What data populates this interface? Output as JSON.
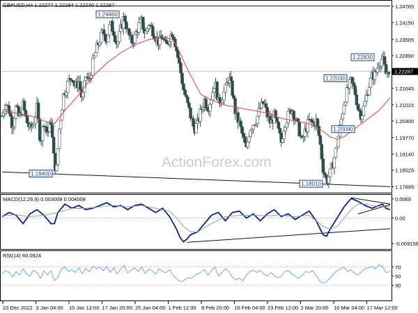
{
  "chart_data": [
    {
      "type": "candlestick",
      "title": "GBPUSD,H4  1.22277 1.22294 1.22230 1.22287",
      "ylim": [
        1.1775,
        1.2485
      ],
      "y_ticks": [
        "1.24765",
        "1.24150",
        "1.23505",
        "1.22890",
        "1.22287",
        "1.21645",
        "1.21015",
        "1.20400",
        "1.19770",
        "1.19140",
        "1.18525",
        "1.17895"
      ],
      "current_price": "1.22287",
      "x_ticks": [
        "23 Dec 2022",
        "3 Jan 04:00",
        "10 Jan 12:00",
        "17 Jan 20:00",
        "25 Jan 04:00",
        "1 Feb 12:00",
        "8 Feb 20:00",
        "16 Feb 04:00",
        "23 Feb 12:00",
        "2 Mar 20:00",
        "10 Mar 04:00",
        "17 Mar 12:00"
      ],
      "annotations": [
        {
          "label": "1.24460",
          "value": 1.2446
        },
        {
          "label": "1.18400",
          "value": 1.184
        },
        {
          "label": "1.22830",
          "value": 1.2283
        },
        {
          "label": "1.22030",
          "value": 1.2203
        },
        {
          "label": "1.20090",
          "value": 1.2009
        },
        {
          "label": "1.18010",
          "value": 1.1801
        }
      ],
      "price_path": [
        [
          0,
          1.206
        ],
        [
          5,
          1.211
        ],
        [
          10,
          1.208
        ],
        [
          15,
          1.202
        ],
        [
          20,
          1.209
        ],
        [
          25,
          1.205
        ],
        [
          30,
          1.21
        ],
        [
          35,
          1.204
        ],
        [
          40,
          1.201
        ],
        [
          45,
          1.203
        ],
        [
          50,
          1.209
        ],
        [
          55,
          1.196
        ],
        [
          60,
          1.204
        ],
        [
          65,
          1.199
        ],
        [
          70,
          1.204
        ],
        [
          75,
          1.187
        ],
        [
          78,
          1.186
        ],
        [
          82,
          1.201
        ],
        [
          88,
          1.214
        ],
        [
          95,
          1.219
        ],
        [
          100,
          1.221
        ],
        [
          105,
          1.217
        ],
        [
          110,
          1.219
        ],
        [
          115,
          1.212
        ],
        [
          120,
          1.221
        ],
        [
          125,
          1.219
        ],
        [
          130,
          1.226
        ],
        [
          135,
          1.231
        ],
        [
          140,
          1.235
        ],
        [
          145,
          1.238
        ],
        [
          150,
          1.235
        ],
        [
          155,
          1.241
        ],
        [
          160,
          1.238
        ],
        [
          165,
          1.233
        ],
        [
          170,
          1.239
        ],
        [
          175,
          1.244
        ],
        [
          180,
          1.238
        ],
        [
          185,
          1.234
        ],
        [
          190,
          1.236
        ],
        [
          195,
          1.24
        ],
        [
          200,
          1.242
        ],
        [
          205,
          1.237
        ],
        [
          210,
          1.241
        ],
        [
          215,
          1.239
        ],
        [
          220,
          1.236
        ],
        [
          225,
          1.234
        ],
        [
          230,
          1.236
        ],
        [
          235,
          1.232
        ],
        [
          240,
          1.236
        ],
        [
          245,
          1.238
        ],
        [
          250,
          1.231
        ],
        [
          255,
          1.224
        ],
        [
          260,
          1.216
        ],
        [
          265,
          1.211
        ],
        [
          270,
          1.206
        ],
        [
          275,
          1.201
        ],
        [
          280,
          1.203
        ],
        [
          285,
          1.208
        ],
        [
          290,
          1.212
        ],
        [
          295,
          1.209
        ],
        [
          300,
          1.213
        ],
        [
          305,
          1.219
        ],
        [
          310,
          1.211
        ],
        [
          315,
          1.213
        ],
        [
          320,
          1.216
        ],
        [
          325,
          1.221
        ],
        [
          330,
          1.215
        ],
        [
          335,
          1.206
        ],
        [
          340,
          1.203
        ],
        [
          345,
          1.198
        ],
        [
          350,
          1.193
        ],
        [
          355,
          1.201
        ],
        [
          360,
          1.203
        ],
        [
          365,
          1.205
        ],
        [
          370,
          1.209
        ],
        [
          375,
          1.211
        ],
        [
          380,
          1.206
        ],
        [
          385,
          1.203
        ],
        [
          390,
          1.206
        ],
        [
          395,
          1.201
        ],
        [
          400,
          1.196
        ],
        [
          405,
          1.203
        ],
        [
          410,
          1.206
        ],
        [
          415,
          1.209
        ],
        [
          420,
          1.205
        ],
        [
          425,
          1.201
        ],
        [
          430,
          1.196
        ],
        [
          435,
          1.201
        ],
        [
          440,
          1.204
        ],
        [
          445,
          1.203
        ],
        [
          450,
          1.204
        ],
        [
          455,
          1.197
        ],
        [
          460,
          1.186
        ],
        [
          465,
          1.181
        ],
        [
          470,
          1.184
        ],
        [
          475,
          1.189
        ],
        [
          480,
          1.195
        ],
        [
          485,
          1.203
        ],
        [
          490,
          1.211
        ],
        [
          495,
          1.216
        ],
        [
          500,
          1.219
        ],
        [
          505,
          1.216
        ],
        [
          510,
          1.209
        ],
        [
          515,
          1.206
        ],
        [
          520,
          1.211
        ],
        [
          525,
          1.217
        ],
        [
          530,
          1.221
        ],
        [
          535,
          1.222
        ],
        [
          540,
          1.226
        ],
        [
          545,
          1.228
        ],
        [
          550,
          1.222
        ],
        [
          555,
          1.224
        ]
      ],
      "ma_path": [
        [
          0,
          1.208
        ],
        [
          20,
          1.207
        ],
        [
          40,
          1.206
        ],
        [
          60,
          1.204
        ],
        [
          75,
          1.203
        ],
        [
          90,
          1.208
        ],
        [
          110,
          1.214
        ],
        [
          130,
          1.221
        ],
        [
          150,
          1.226
        ],
        [
          170,
          1.23
        ],
        [
          190,
          1.233
        ],
        [
          210,
          1.235
        ],
        [
          230,
          1.236
        ],
        [
          245,
          1.235
        ],
        [
          255,
          1.23
        ],
        [
          265,
          1.224
        ],
        [
          275,
          1.219
        ],
        [
          285,
          1.214
        ],
        [
          300,
          1.212
        ],
        [
          320,
          1.21
        ],
        [
          340,
          1.209
        ],
        [
          360,
          1.208
        ],
        [
          380,
          1.207
        ],
        [
          400,
          1.205
        ],
        [
          420,
          1.204
        ],
        [
          440,
          1.203
        ],
        [
          460,
          1.2
        ],
        [
          470,
          1.198
        ],
        [
          480,
          1.197
        ],
        [
          490,
          1.198
        ],
        [
          500,
          1.2
        ],
        [
          510,
          1.202
        ],
        [
          520,
          1.204
        ],
        [
          530,
          1.206
        ],
        [
          540,
          1.208
        ],
        [
          550,
          1.211
        ],
        [
          556,
          1.213
        ]
      ],
      "colors": {
        "candles": "#2f4f4f",
        "moving_average": "#e8474b",
        "annotation_box": "#1f3f8f"
      }
    },
    {
      "type": "line",
      "title": "MACD(12,26,9) 0.003008 0.004008",
      "ylim": [
        -0.0106,
        0.0076
      ],
      "y_ticks": [
        "0.0069",
        "0.00",
        "-0.009158"
      ],
      "series": [
        {
          "name": "MACD",
          "color": "#0a1f8a",
          "x": [
            0,
            10,
            20,
            30,
            40,
            50,
            60,
            70,
            75,
            80,
            90,
            100,
            110,
            120,
            130,
            140,
            150,
            160,
            170,
            180,
            190,
            200,
            210,
            220,
            230,
            240,
            250,
            255,
            260,
            265,
            270,
            280,
            290,
            300,
            310,
            320,
            330,
            340,
            350,
            360,
            370,
            380,
            390,
            400,
            410,
            420,
            430,
            440,
            450,
            460,
            465,
            470,
            480,
            490,
            500,
            510,
            520,
            530,
            540,
            545,
            550,
            556
          ],
          "values": [
            0.0005,
            0.002,
            0.001,
            -0.002,
            0.0015,
            0.003,
            0.001,
            -0.002,
            -0.002,
            0.002,
            0.005,
            0.0035,
            0.0045,
            0.003,
            0.0035,
            0.0045,
            0.0055,
            0.004,
            0.0045,
            0.003,
            0.0045,
            0.005,
            0.0035,
            0.002,
            0.0035,
            0.0005,
            -0.004,
            -0.007,
            -0.0085,
            -0.0075,
            -0.006,
            -0.005,
            -0.002,
            0.001,
            0.002,
            -0.001,
            0.002,
            0.0025,
            0.0,
            0.0015,
            -0.001,
            0.0015,
            0.003,
            0.0005,
            0.0015,
            -0.0005,
            0.001,
            0.0025,
            -0.001,
            -0.006,
            -0.0065,
            -0.004,
            0.0,
            0.004,
            0.007,
            0.006,
            0.0045,
            0.0035,
            0.0045,
            0.005,
            0.0035,
            0.003
          ]
        },
        {
          "name": "Signal",
          "color": "#9a9a9a",
          "x": [
            0,
            20,
            40,
            60,
            80,
            100,
            120,
            140,
            160,
            180,
            200,
            220,
            240,
            250,
            260,
            270,
            280,
            300,
            320,
            340,
            360,
            380,
            400,
            420,
            440,
            460,
            470,
            480,
            490,
            500,
            510,
            520,
            530,
            540,
            550,
            556
          ],
          "values": [
            0.0008,
            0.0012,
            0.0005,
            0.001,
            0.002,
            0.0035,
            0.0035,
            0.004,
            0.0045,
            0.004,
            0.0045,
            0.0035,
            0.0025,
            0.0,
            -0.003,
            -0.005,
            -0.005,
            -0.002,
            0.0005,
            0.001,
            0.001,
            0.0008,
            0.001,
            0.0005,
            0.001,
            -0.003,
            -0.004,
            -0.003,
            0.0,
            0.003,
            0.005,
            0.005,
            0.0045,
            0.0042,
            0.0041,
            0.004
          ]
        }
      ]
    },
    {
      "type": "line",
      "title": "RSI(14) 60.0924",
      "ylim": [
        0,
        100
      ],
      "y_ticks": [
        "70",
        "50",
        "30"
      ],
      "series": [
        {
          "name": "RSI",
          "color": "#6ba6de",
          "x": [
            0,
            5,
            10,
            15,
            20,
            25,
            30,
            35,
            40,
            45,
            50,
            55,
            60,
            65,
            70,
            75,
            80,
            85,
            90,
            95,
            100,
            105,
            110,
            115,
            120,
            125,
            130,
            135,
            140,
            145,
            150,
            155,
            160,
            165,
            170,
            175,
            180,
            185,
            190,
            195,
            200,
            205,
            210,
            215,
            220,
            225,
            230,
            235,
            240,
            245,
            250,
            255,
            260,
            265,
            270,
            275,
            280,
            285,
            290,
            295,
            300,
            305,
            310,
            315,
            320,
            325,
            330,
            335,
            340,
            345,
            350,
            355,
            360,
            365,
            370,
            375,
            380,
            385,
            390,
            395,
            400,
            405,
            410,
            415,
            420,
            425,
            430,
            435,
            440,
            445,
            450,
            455,
            460,
            465,
            470,
            475,
            480,
            485,
            490,
            495,
            500,
            505,
            510,
            515,
            520,
            525,
            530,
            535,
            540,
            545,
            550,
            556
          ],
          "values": [
            55,
            62,
            58,
            48,
            60,
            52,
            66,
            55,
            50,
            63,
            58,
            45,
            61,
            53,
            62,
            40,
            48,
            65,
            70,
            60,
            64,
            58,
            68,
            55,
            67,
            59,
            72,
            66,
            70,
            62,
            71,
            58,
            68,
            55,
            66,
            73,
            57,
            63,
            68,
            60,
            70,
            56,
            65,
            62,
            54,
            66,
            60,
            58,
            64,
            52,
            44,
            38,
            40,
            46,
            45,
            50,
            55,
            58,
            64,
            52,
            62,
            70,
            50,
            58,
            66,
            60,
            48,
            42,
            46,
            40,
            52,
            60,
            63,
            58,
            62,
            55,
            50,
            58,
            52,
            46,
            50,
            60,
            62,
            55,
            50,
            45,
            52,
            60,
            58,
            62,
            52,
            40,
            34,
            38,
            46,
            55,
            62,
            66,
            70,
            60,
            64,
            56,
            52,
            60,
            66,
            68,
            72,
            66,
            75,
            70,
            58,
            60
          ]
        }
      ]
    }
  ],
  "watermark": "ActionForex.com"
}
